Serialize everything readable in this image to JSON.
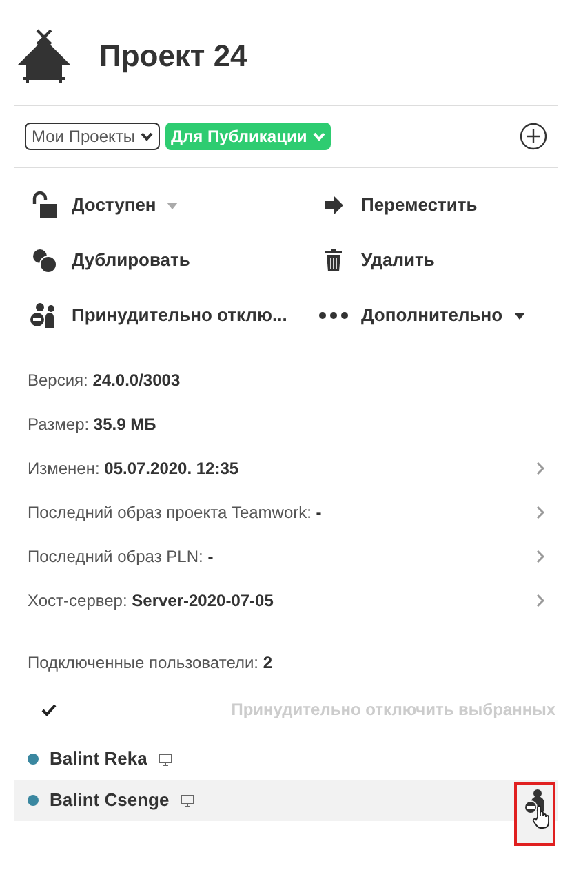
{
  "header": {
    "title": "Проект 24"
  },
  "filters": [
    {
      "kind": "select",
      "label": "Мои Проекты"
    },
    {
      "kind": "tag",
      "label": "Для Публикации"
    }
  ],
  "actions": [
    {
      "label": "Доступен",
      "dropdown": true,
      "dropdown_disabled": true
    },
    {
      "label": "Переместить",
      "dropdown": false
    },
    {
      "label": "Дублировать",
      "dropdown": false
    },
    {
      "label": "Удалить",
      "dropdown": false
    },
    {
      "label": "Принудительно отклю...",
      "dropdown": false
    },
    {
      "label": "Дополнительно",
      "dropdown": true,
      "dropdown_disabled": false
    }
  ],
  "info": [
    {
      "text": "Версия: **24.0.0/3003**",
      "expandable": false
    },
    {
      "text": "Размер: **35.9 МБ**",
      "expandable": false
    },
    {
      "text": "Изменен: **05.07.2020. 12:35**",
      "expandable": true
    },
    {
      "text": "Последний образ проекта Teamwork: **-**",
      "expandable": true
    },
    {
      "text": "Последний образ PLN: **-**",
      "expandable": true
    },
    {
      "text": "Хост-сервер: **Server-2020-07-05**",
      "expandable": true
    }
  ],
  "users_summary": {
    "label": "Подключенные пользователи: ",
    "count": "2"
  },
  "bulk": {
    "action": "Принудительно отключить выбранных",
    "disabled": true
  },
  "users": [
    {
      "name": "Balint Reka",
      "color": "#3a87a0",
      "hovered": false
    },
    {
      "name": "Balint Csenge",
      "color": "#3a87a0",
      "hovered": true
    }
  ]
}
